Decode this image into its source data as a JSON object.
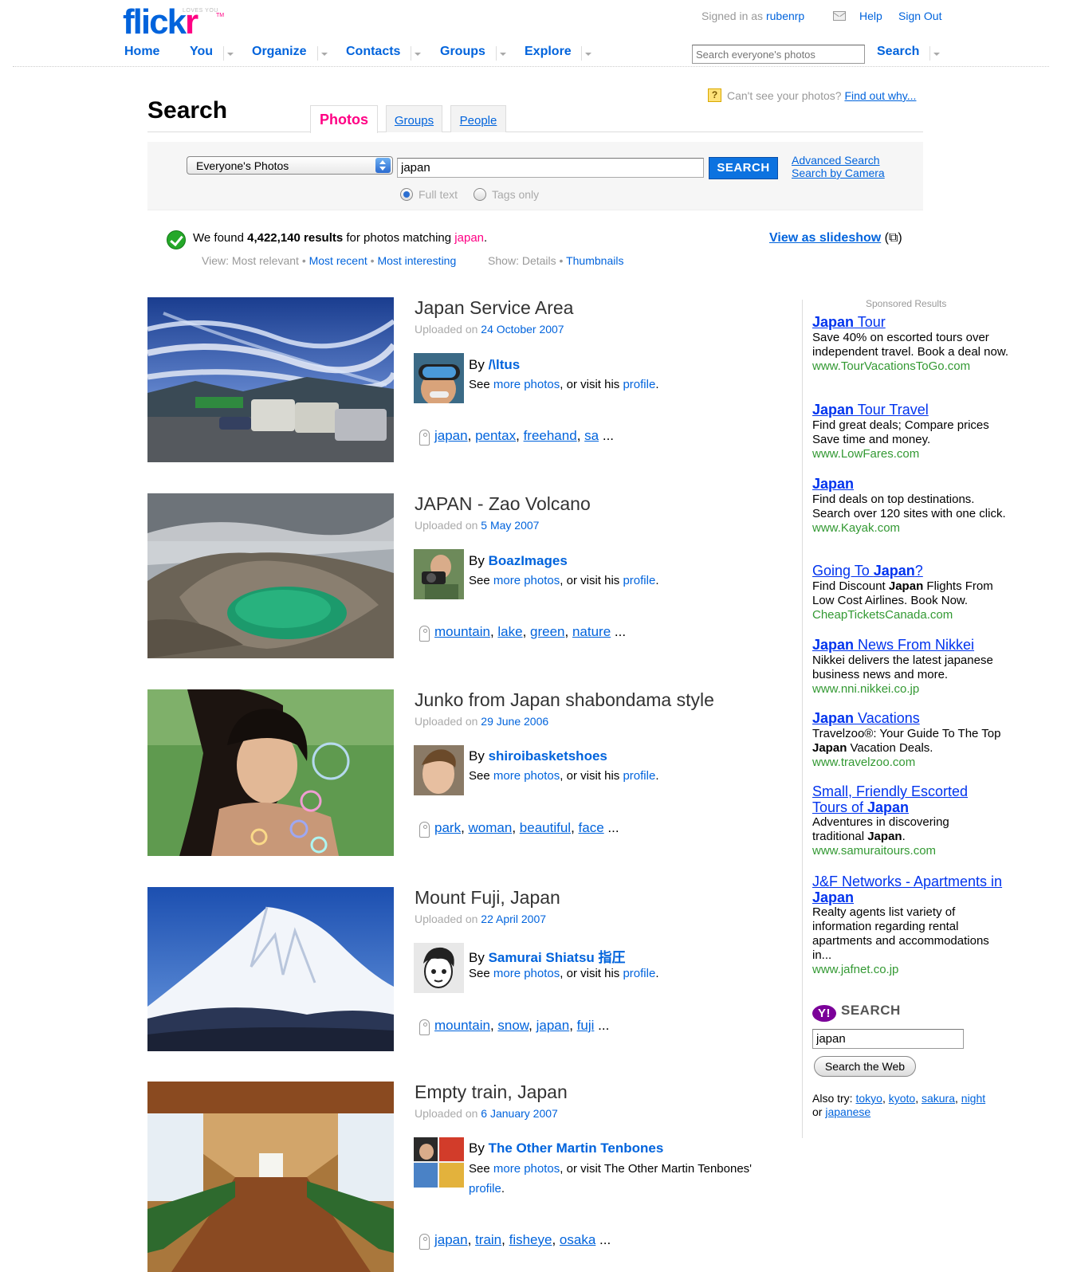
{
  "header": {
    "logo_main": "flick",
    "logo_r": "r",
    "logo_tagline": "LOVES YOU",
    "logo_tm": "TM",
    "signed_in_prefix": "Signed in as",
    "username": "rubenrp",
    "help": "Help",
    "sign_out": "Sign Out",
    "nav": {
      "home": "Home",
      "you": "You",
      "organize": "Organize",
      "contacts": "Contacts",
      "groups": "Groups",
      "explore": "Explore"
    },
    "search_placeholder": "Search everyone's photos",
    "search_button": "Search"
  },
  "search": {
    "help_glyph": "?",
    "cant_see": "Can't see your photos?",
    "find_out": "Find out why...",
    "title": "Search",
    "tabs": {
      "photos": "Photos",
      "groups": "Groups",
      "people": "People"
    },
    "scope_selected": "Everyone's Photos",
    "query": "japan",
    "button": "SEARCH",
    "advanced": "Advanced Search",
    "by_camera": "Search by Camera",
    "radio_full_text": "Full text",
    "radio_tags_only": "Tags only"
  },
  "summary": {
    "prefix": "We found",
    "count": "4,422,140 results",
    "middle": "for photos matching",
    "query": "japan",
    "suffix": ".",
    "view_label": "View:",
    "view_relevant": "Most relevant",
    "view_recent": "Most recent",
    "view_interesting": "Most interesting",
    "show_label": "Show:",
    "show_details": "Details",
    "show_thumbnails": "Thumbnails",
    "bullet": "•",
    "slideshow": "View as slideshow",
    "slideshow_icon": "(⧉)"
  },
  "common": {
    "uploaded_on": "Uploaded on",
    "by": "By",
    "see": "See",
    "more_photos": "more photos",
    "or_visit_his": ", or visit his",
    "profile": "profile",
    "period": ".",
    "ellipsis": "..."
  },
  "results": [
    {
      "title": "Japan Service Area",
      "date": "24 October 2007",
      "author": "/\\ltus",
      "tags": [
        "japan",
        "pentax",
        "freehand",
        "sa"
      ]
    },
    {
      "title": "JAPAN - Zao Volcano",
      "date": "5 May 2007",
      "author": "BoazImages",
      "tags": [
        "mountain",
        "lake",
        "green",
        "nature"
      ]
    },
    {
      "title": "Junko from Japan shabondama style",
      "date": "29 June 2006",
      "author": "shiroibasketshoes",
      "tags": [
        "park",
        "woman",
        "beautiful",
        "face"
      ]
    },
    {
      "title": "Mount Fuji, Japan",
      "date": "22 April 2007",
      "author": "Samurai Shiatsu 指圧",
      "tags": [
        "mountain",
        "snow",
        "japan",
        "fuji"
      ]
    },
    {
      "title": "Empty train, Japan",
      "date": "6 January 2007",
      "author": "The Other Martin Tenbones",
      "visit_text": ", or visit The Other Martin Tenbones'",
      "tags": [
        "japan",
        "train",
        "fisheye",
        "osaka"
      ]
    }
  ],
  "sidebar": {
    "sponsored_label": "Sponsored Results",
    "ads": [
      {
        "title_parts": [
          [
            "b",
            "Japan"
          ],
          [
            "n",
            " Tour"
          ]
        ],
        "body": [
          [
            "n",
            "Save 40% on escorted tours over independent travel. Book a deal now."
          ]
        ],
        "url": "www.TourVacationsToGo.com"
      },
      {
        "title_parts": [
          [
            "b",
            "Japan"
          ],
          [
            "n",
            " Tour Travel"
          ]
        ],
        "body": [
          [
            "n",
            "Find great deals; Compare prices Save time and money."
          ]
        ],
        "url": "www.LowFares.com"
      },
      {
        "title_parts": [
          [
            "b",
            "Japan"
          ]
        ],
        "body": [
          [
            "n",
            "Find deals on top destinations. Search over 120 sites with one click."
          ]
        ],
        "url": "www.Kayak.com"
      },
      {
        "title_parts": [
          [
            "n",
            "Going To "
          ],
          [
            "b",
            "Japan"
          ],
          [
            "n",
            "?"
          ]
        ],
        "body": [
          [
            "n",
            "Find Discount "
          ],
          [
            "b",
            "Japan"
          ],
          [
            "n",
            " Flights From Low Cost Airlines. Book Now."
          ]
        ],
        "url": "CheapTicketsCanada.com"
      },
      {
        "title_parts": [
          [
            "b",
            "Japan"
          ],
          [
            "n",
            " News From Nikkei"
          ]
        ],
        "body": [
          [
            "n",
            "Nikkei delivers the latest japanese business news and more."
          ]
        ],
        "url": "www.nni.nikkei.co.jp"
      },
      {
        "title_parts": [
          [
            "b",
            "Japan"
          ],
          [
            "n",
            " Vacations"
          ]
        ],
        "body": [
          [
            "n",
            "Travelzoo®: Your Guide To The Top "
          ],
          [
            "b",
            "Japan"
          ],
          [
            "n",
            " Vacation Deals."
          ]
        ],
        "url": "www.travelzoo.com"
      },
      {
        "title_parts": [
          [
            "n",
            "Small, Friendly Escorted Tours of "
          ],
          [
            "b",
            "Japan"
          ]
        ],
        "body": [
          [
            "n",
            "Adventures in discovering traditional "
          ],
          [
            "b",
            "Japan"
          ],
          [
            "n",
            "."
          ]
        ],
        "url": "www.samuraitours.com"
      },
      {
        "title_parts": [
          [
            "n",
            "J&F Networks - Apartments in "
          ],
          [
            "b",
            "Japan"
          ]
        ],
        "body": [
          [
            "n",
            "Realty agents list variety of information regarding rental apartments and accommodations in..."
          ]
        ],
        "url": "www.jafnet.co.jp"
      }
    ],
    "yahoo_logo": "Y!",
    "yahoo_search_label": "SEARCH",
    "web_query": "japan",
    "web_button": "Search the Web",
    "also_try_label": "Also try:",
    "also_try": [
      "tokyo",
      "kyoto",
      "sakura",
      "night"
    ],
    "also_try_or": "or",
    "also_try_last": "japanese"
  },
  "colors": {
    "brand_blue": "#0063dc",
    "brand_pink": "#ff0084",
    "ad_title": "#0033ee",
    "ad_url": "#339933"
  }
}
